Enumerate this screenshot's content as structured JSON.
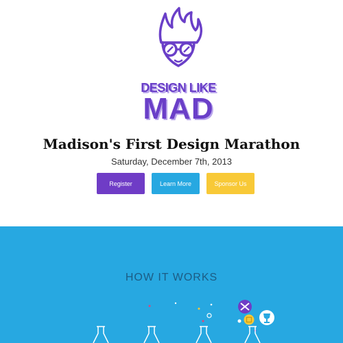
{
  "logo": {
    "line1": "DESIGN LIKE",
    "line2": "MAD"
  },
  "event": {
    "title": "Madison's First Design Marathon",
    "date": "Saturday, December 7th, 2013"
  },
  "buttons": {
    "register": "Register",
    "learn_more": "Learn More",
    "sponsor": "Sponsor Us"
  },
  "how_it_works": {
    "title": "HOW IT WORKS"
  },
  "icons": {
    "logo": "mad-scientist-logo-icon",
    "flasks": [
      "flask-icon",
      "flask-icon",
      "flask-icon",
      "flask-icon"
    ],
    "badges": [
      "shuffle-badge-icon",
      "gold-coin-badge-icon",
      "trophy-badge-icon"
    ]
  },
  "colors": {
    "brand_purple": "#6f3cc6",
    "brand_blue": "#27a8e1",
    "brand_yellow": "#f8c937",
    "section_title": "#1c5c84"
  }
}
